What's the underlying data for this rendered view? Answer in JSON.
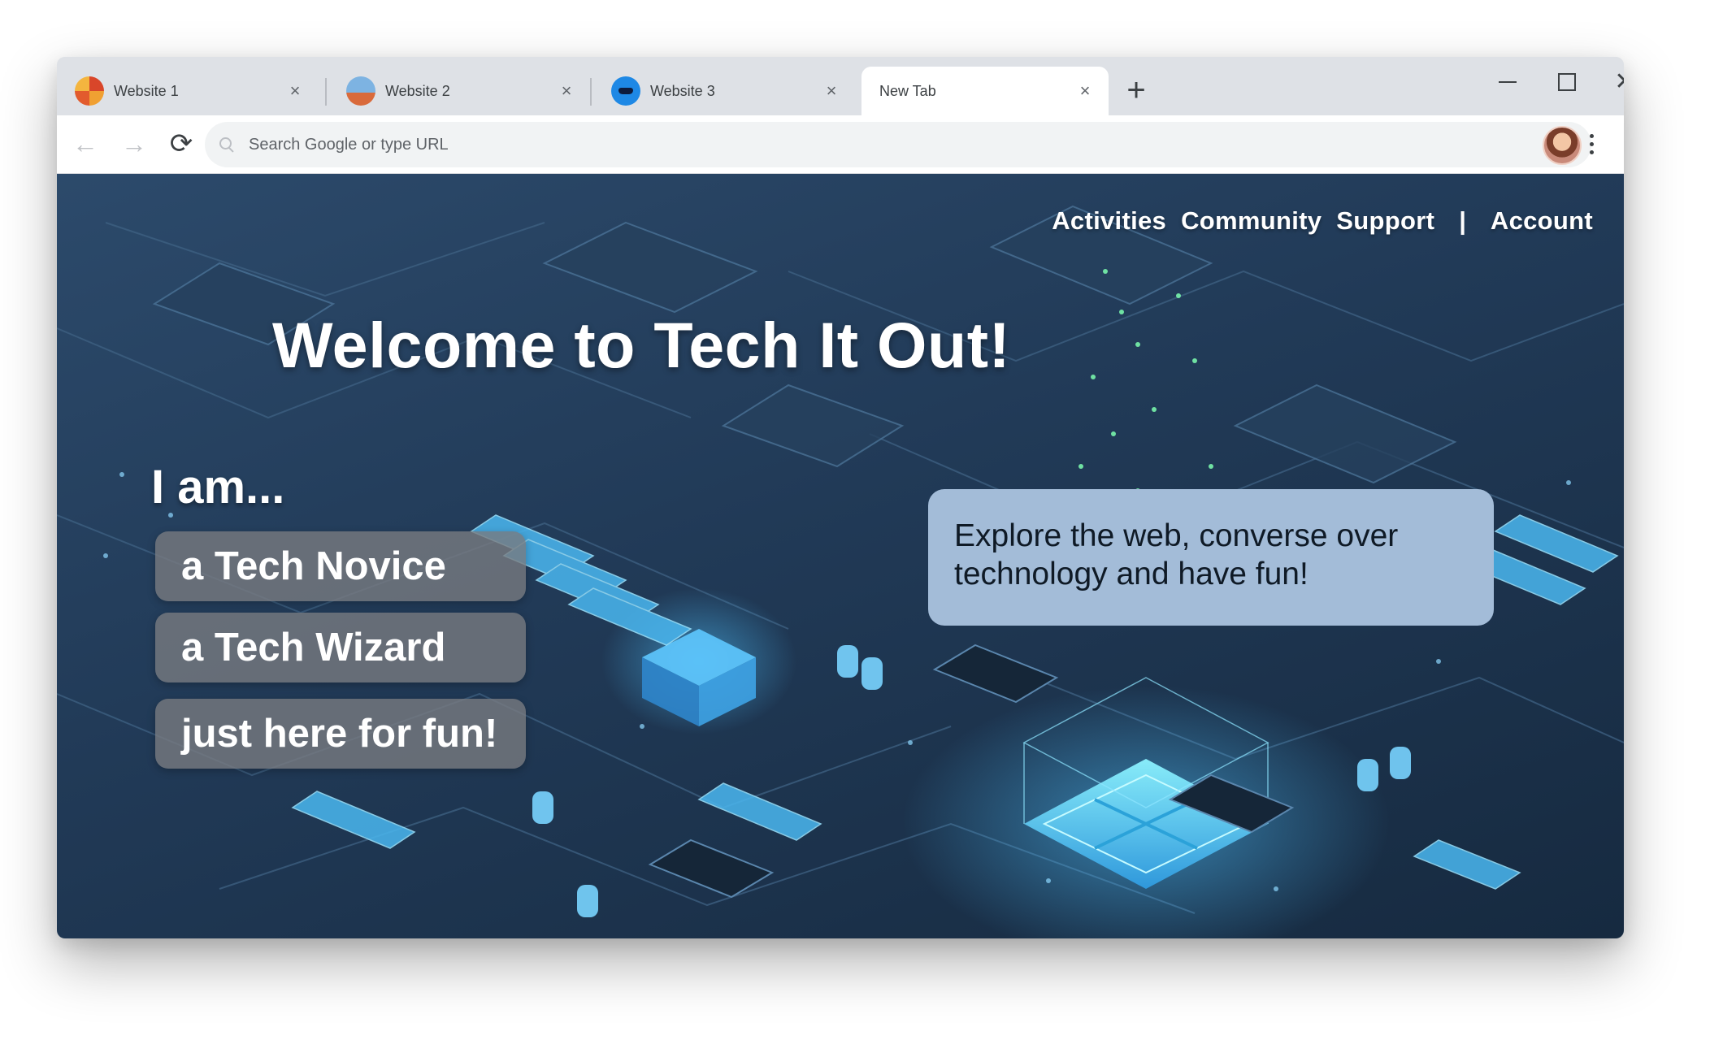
{
  "browser": {
    "tabs": [
      {
        "title": "Website 1",
        "favicon": "website-1-favicon",
        "active": false
      },
      {
        "title": "Website 2",
        "favicon": "website-2-favicon",
        "active": false
      },
      {
        "title": "Website 3",
        "favicon": "website-3-favicon",
        "active": false
      },
      {
        "title": "New Tab",
        "favicon": "",
        "active": true
      }
    ],
    "tab_close_glyph": "×",
    "new_tab_glyph": "+",
    "window_close_glyph": "✕",
    "back_glyph": "←",
    "forward_glyph": "→",
    "reload_glyph": "⟳",
    "star_glyph": "☆",
    "address_placeholder": "Search Google or type URL",
    "address_value": ""
  },
  "site": {
    "nav": {
      "activities": "Activities",
      "community": "Community",
      "support": "Support",
      "separator": "|",
      "account": "Account"
    },
    "title": "Welcome to Tech It Out!",
    "prompt": "I am...",
    "choices": [
      "a Tech Novice",
      "a Tech Wizard",
      "just here for fun!"
    ],
    "tagline": "Explore the web, converse over technology and have fun!"
  },
  "colors": {
    "tabstrip": "#dee1e6",
    "background_top": "#2c4a6b",
    "background_bottom": "#162a40",
    "circuit_glow": "#56c8ff",
    "choice_button": "#787a80",
    "info_box": "#a3bcd8"
  }
}
